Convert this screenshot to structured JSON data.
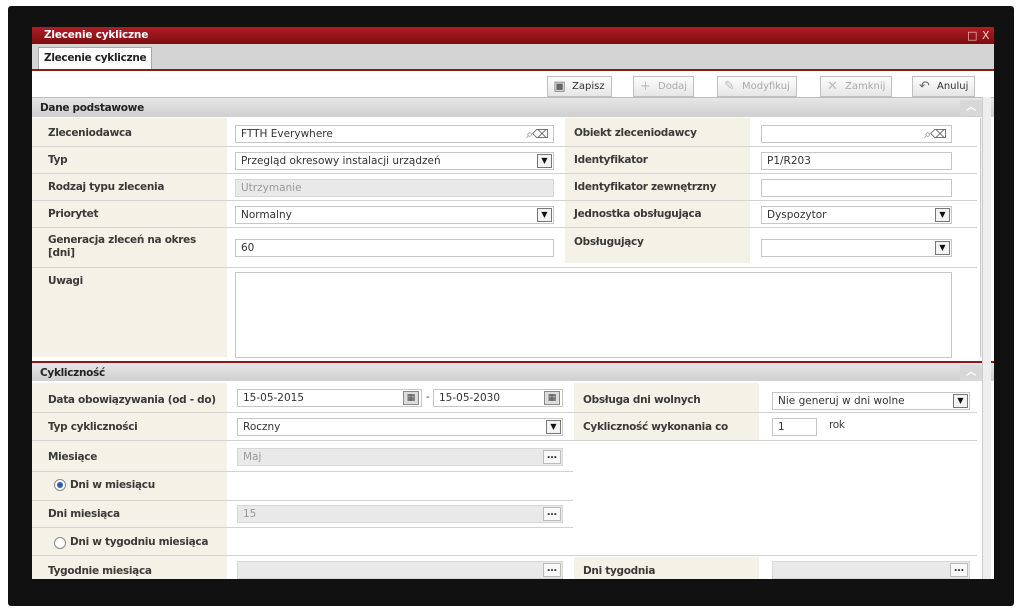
{
  "window": {
    "title": "Zlecenie cykliczne",
    "controls": [
      "□",
      "X"
    ]
  },
  "tabs": [
    {
      "label": "Zlecenie cykliczne",
      "active": true
    }
  ],
  "toolbar": {
    "save": "Zapisz",
    "add": "Dodaj",
    "modify": "Modyfikuj",
    "close": "Zamknij",
    "cancel": "Anuluj"
  },
  "basic": {
    "heading": "Dane podstawowe",
    "client_label": "Zleceniodawca",
    "client_value": "FTTH Everywhere",
    "client_object_label": "Obiekt zleceniodawcy",
    "client_object_value": "",
    "type_label": "Typ",
    "type_value": "Przegląd okresowy instalacji urządzeń",
    "identifier_label": "Identyfikator",
    "identifier_value": "P1/R203",
    "order_type_label": "Rodzaj typu zlecenia",
    "order_type_value": "Utrzymanie",
    "ext_identifier_label": "Identyfikator zewnętrzny",
    "ext_identifier_value": "",
    "priority_label": "Priorytet",
    "priority_value": "Normalny",
    "unit_label": "Jednostka obsługująca",
    "unit_value": "Dyspozytor",
    "generation_label": "Generacja zleceń na okres [dni]",
    "generation_value": "60",
    "handler_label": "Obsługujący",
    "handler_value": "",
    "notes_label": "Uwagi",
    "notes_value": ""
  },
  "cycle": {
    "heading": "Cykliczność",
    "validity_label": "Data obowiązywania (od - do)",
    "date_from": "15-05-2015",
    "date_sep": "-",
    "date_to": "15-05-2030",
    "free_days_label": "Obsługa dni wolnych",
    "free_days_value": "Nie generuj w dni wolne",
    "cycle_type_label": "Typ cykliczności",
    "cycle_type_value": "Roczny",
    "every_label": "Cykliczność wykonania co",
    "every_value": "1",
    "every_unit": "rok",
    "months_label": "Miesiące",
    "months_value": "Maj",
    "days_in_month_radio": "Dni w miesiącu",
    "month_days_label": "Dni miesiąca",
    "month_days_value": "15",
    "days_in_week_radio": "Dni w tygodniu miesiąca",
    "weeks_label": "Tygodnie miesiąca",
    "weeks_value": "",
    "weekdays_label": "Dni tygodnia",
    "weekdays_value": ""
  }
}
